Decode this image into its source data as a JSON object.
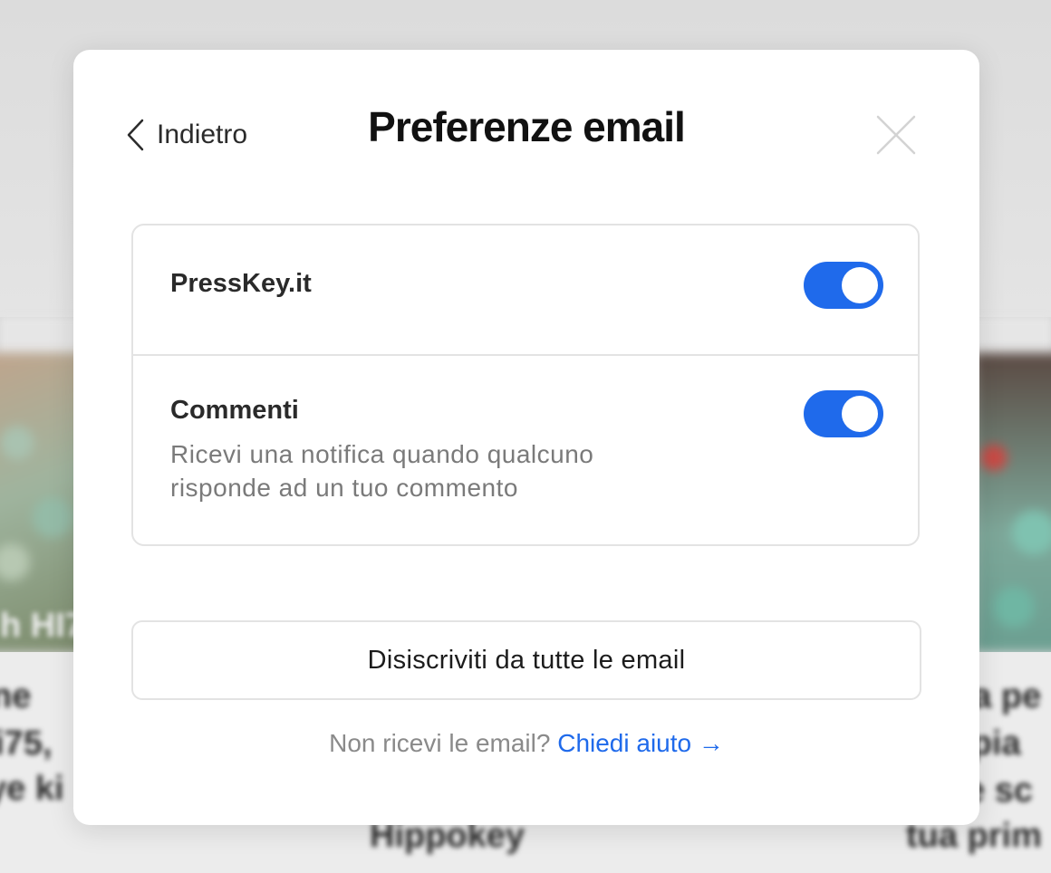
{
  "background": {
    "visible_words": [
      "h HI7",
      "ne",
      "i75,",
      "ye ki",
      "Hippokey",
      "da pe",
      "cipia",
      "e sc",
      "tua prim"
    ]
  },
  "modal": {
    "back_label": "Indietro",
    "title": "Preferenze email",
    "preferences": [
      {
        "label": "PressKey.it",
        "description": "",
        "enabled": true
      },
      {
        "label": "Commenti",
        "description": "Ricevi una notifica quando qualcuno risponde ad un tuo commento",
        "enabled": true
      }
    ],
    "unsubscribe_label": "Disiscriviti da tutte le email",
    "help_prefix": "Non ricevi le email?",
    "help_link_label": "Chiedi aiuto →"
  },
  "colors": {
    "accent": "#1f6aeb",
    "toggle_knob": "#ffffff",
    "border": "#e3e3e3",
    "muted_text": "#7a7a7a"
  },
  "icons": {
    "back": "chevron-left-icon",
    "close": "close-icon"
  }
}
